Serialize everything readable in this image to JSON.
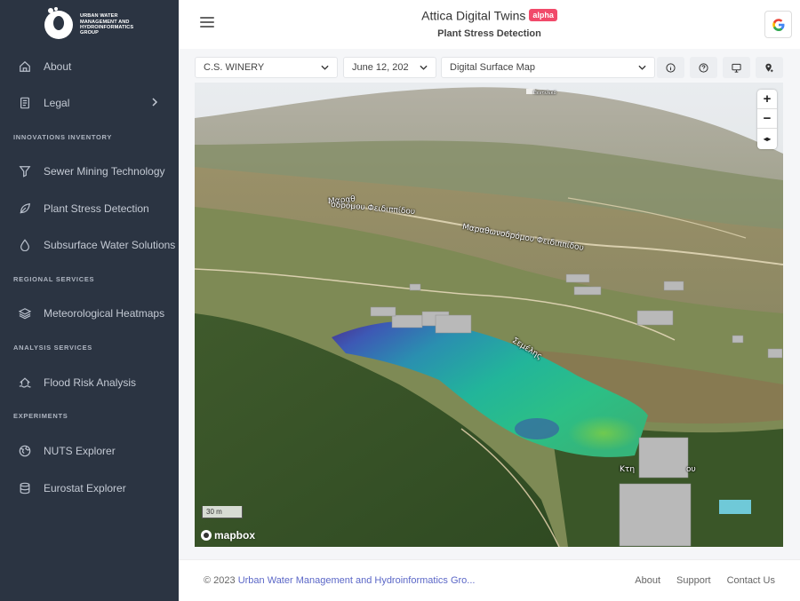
{
  "sidebar": {
    "logo_text": "URBAN WATER MANAGEMENT AND HYDROINFORMATICS GROUP",
    "items": [
      {
        "label": "About",
        "icon": "home-icon"
      },
      {
        "label": "Legal",
        "icon": "document-icon"
      },
      {
        "label": "Sewer Mining Technology",
        "icon": "filter-icon"
      },
      {
        "label": "Plant Stress Detection",
        "icon": "leaf-icon"
      },
      {
        "label": "Subsurface Water Solutions",
        "icon": "droplet-icon"
      },
      {
        "label": "Meteorological Heatmaps",
        "icon": "layers-icon"
      },
      {
        "label": "Flood Risk Analysis",
        "icon": "house-flood-icon"
      },
      {
        "label": "NUTS Explorer",
        "icon": "globe-icon"
      },
      {
        "label": "Eurostat Explorer",
        "icon": "database-icon"
      }
    ],
    "sections": {
      "innovations": "INNOVATIONS INVENTORY",
      "regional": "REGIONAL SERVICES",
      "analysis": "ANALYSIS SERVICES",
      "experiments": "EXPERIMENTS"
    }
  },
  "header": {
    "title": "Attica Digital Twins",
    "badge": "alpha",
    "subtitle": "Plant Stress Detection",
    "google_letter": "G"
  },
  "toolbar": {
    "site_select": "C.S. WINERY",
    "date_select": "June 12, 202",
    "layer_select": "Digital Surface Map",
    "buttons": [
      "info-icon",
      "help-icon",
      "monitor-icon",
      "location-pin-icon"
    ]
  },
  "map": {
    "labels": {
      "road1a": "οδρόμου Φειδιππίδου",
      "road1b": "Μαραθ",
      "road2": "Μαραθωνοδρόμου Φειδιππίδου",
      "road3": "Σεμέλης",
      "road4": "Κτη",
      "road4b": "ου",
      "peak": "Πεντελικό"
    },
    "zoom_in": "+",
    "zoom_out": "−",
    "compass": "◂▸",
    "scale": "30 m",
    "attribution": "mapbox"
  },
  "footer": {
    "copyright_prefix": "© 2023 ",
    "copyright_link": "Urban Water Management and Hydroinformatics Gro...",
    "links": [
      "About",
      "Support",
      "Contact Us"
    ]
  },
  "colors": {
    "sidebar_bg": "#2b3442",
    "badge": "#f14a6a",
    "link": "#5b67c7"
  }
}
